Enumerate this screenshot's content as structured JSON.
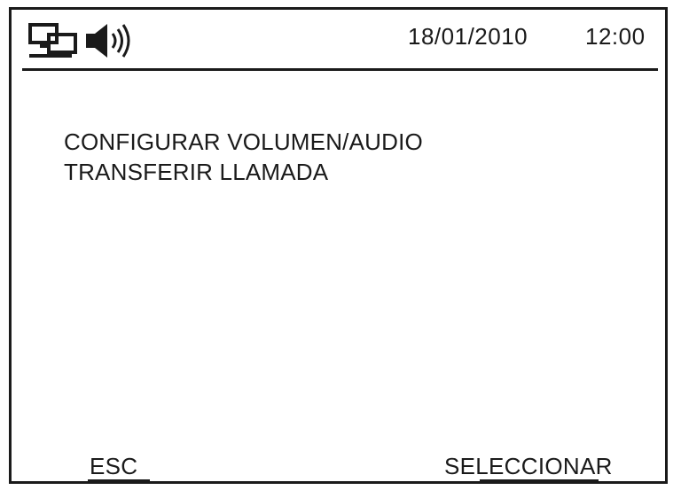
{
  "status_bar": {
    "icons": [
      "network-icon",
      "speaker-icon"
    ],
    "date": "18/01/2010",
    "time": "12:00"
  },
  "menu": {
    "items": [
      {
        "label": "CONFIGURAR VOLUMEN/AUDIO"
      },
      {
        "label": "TRANSFERIR LLAMADA"
      }
    ]
  },
  "softkeys": {
    "left_label": "ESC",
    "right_label": "SELECCIONAR"
  }
}
